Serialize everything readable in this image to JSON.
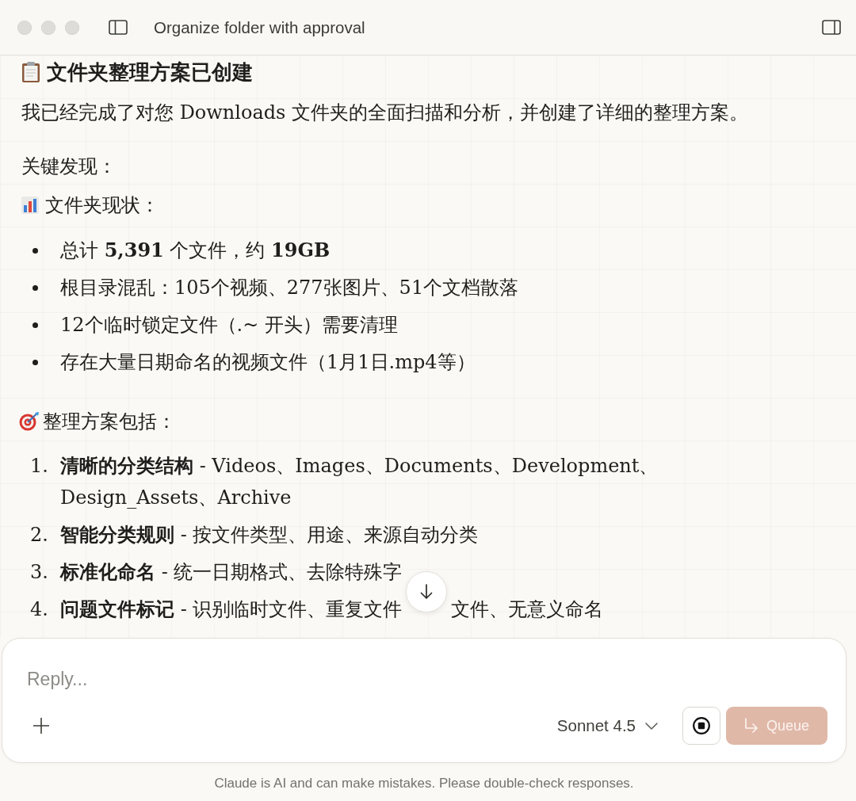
{
  "window": {
    "title": "Organize folder with approval"
  },
  "message": {
    "heading": "文件夹整理方案已创建",
    "intro": "我已经完成了对您 Downloads 文件夹的全面扫描和分析，并创建了详细的整理方案。",
    "findings_label": "关键发现：",
    "status_section": {
      "title": "文件夹现状：",
      "bullets": [
        "总计 **5,391** 个文件，约 **19GB**",
        "根目录混乱：105个视频、277张图片、51个文档散落",
        "12个临时锁定文件（.~ 开头）需要清理",
        "存在大量日期命名的视频文件（1月1日.mp4等）"
      ]
    },
    "plan_section": {
      "title": "整理方案包括：",
      "items": [
        {
          "number": "1.",
          "text": "**清晰的分类结构** - Videos、Images、Documents、Development、Design_Assets、Archive"
        },
        {
          "number": "2.",
          "text": "**智能分类规则** - 按文件类型、用途、来源自动分类"
        },
        {
          "number": "3.",
          "text": "**标准化命名** - 统一日期格式、去除特殊字"
        },
        {
          "number": "4.",
          "text": "**问题文件标记** - 识别临时文件、重复文件",
          "text_after": "文件、无意义命名"
        }
      ]
    }
  },
  "composer": {
    "placeholder": "Reply...",
    "model": "Sonnet 4.5",
    "queue_button": {
      "label": "Queue",
      "disabled": true
    }
  },
  "disclaimer": "Claude is AI and can make mistakes. Please double-check responses."
}
